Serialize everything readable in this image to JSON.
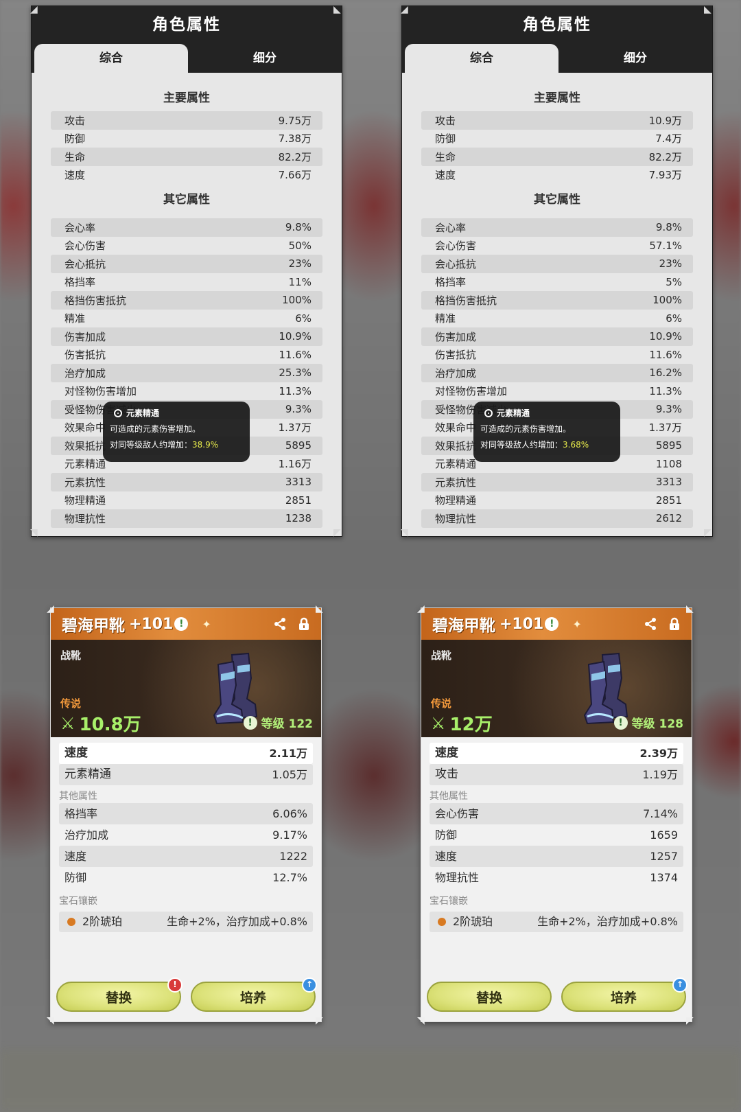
{
  "panels": [
    {
      "title": "角色属性",
      "tabs": [
        "综合",
        "细分"
      ],
      "main_title": "主要属性",
      "main": [
        {
          "label": "攻击",
          "value": "9.75万"
        },
        {
          "label": "防御",
          "value": "7.38万"
        },
        {
          "label": "生命",
          "value": "82.2万"
        },
        {
          "label": "速度",
          "value": "7.66万"
        }
      ],
      "other_title": "其它属性",
      "other": [
        {
          "label": "会心率",
          "value": "9.8%"
        },
        {
          "label": "会心伤害",
          "value": "50%"
        },
        {
          "label": "会心抵抗",
          "value": "23%"
        },
        {
          "label": "格挡率",
          "value": "11%"
        },
        {
          "label": "格挡伤害抵抗",
          "value": "100%"
        },
        {
          "label": "精准",
          "value": "6%"
        },
        {
          "label": "伤害加成",
          "value": "10.9%"
        },
        {
          "label": "伤害抵抗",
          "value": "11.6%"
        },
        {
          "label": "治疗加成",
          "value": "25.3%"
        },
        {
          "label": "对怪物伤害增加",
          "value": "11.3%"
        },
        {
          "label": "受怪物伤害减少",
          "value": "9.3%"
        },
        {
          "label": "效果命中",
          "value": "1.37万"
        },
        {
          "label": "效果抵抗",
          "value": "5895"
        },
        {
          "label": "元素精通",
          "value": "1.16万"
        },
        {
          "label": "元素抗性",
          "value": "3313"
        },
        {
          "label": "物理精通",
          "value": "2851"
        },
        {
          "label": "物理抗性",
          "value": "1238"
        }
      ],
      "tooltip": {
        "title": "元素精通",
        "desc": "可造成的元素伤害增加。",
        "compare_label": "对同等级敌人约增加：",
        "compare_value": "38.9%"
      }
    },
    {
      "title": "角色属性",
      "tabs": [
        "综合",
        "细分"
      ],
      "main_title": "主要属性",
      "main": [
        {
          "label": "攻击",
          "value": "10.9万"
        },
        {
          "label": "防御",
          "value": "7.4万"
        },
        {
          "label": "生命",
          "value": "82.2万"
        },
        {
          "label": "速度",
          "value": "7.93万"
        }
      ],
      "other_title": "其它属性",
      "other": [
        {
          "label": "会心率",
          "value": "9.8%"
        },
        {
          "label": "会心伤害",
          "value": "57.1%"
        },
        {
          "label": "会心抵抗",
          "value": "23%"
        },
        {
          "label": "格挡率",
          "value": "5%"
        },
        {
          "label": "格挡伤害抵抗",
          "value": "100%"
        },
        {
          "label": "精准",
          "value": "6%"
        },
        {
          "label": "伤害加成",
          "value": "10.9%"
        },
        {
          "label": "伤害抵抗",
          "value": "11.6%"
        },
        {
          "label": "治疗加成",
          "value": "16.2%"
        },
        {
          "label": "对怪物伤害增加",
          "value": "11.3%"
        },
        {
          "label": "受怪物伤害减少",
          "value": "9.3%"
        },
        {
          "label": "效果命中",
          "value": "1.37万"
        },
        {
          "label": "效果抵抗",
          "value": "5895"
        },
        {
          "label": "元素精通",
          "value": "1108"
        },
        {
          "label": "元素抗性",
          "value": "3313"
        },
        {
          "label": "物理精通",
          "value": "2851"
        },
        {
          "label": "物理抗性",
          "value": "2612"
        }
      ],
      "tooltip": {
        "title": "元素精通",
        "desc": "可造成的元素伤害增加。",
        "compare_label": "对同等级敌人约增加：",
        "compare_value": "3.68%"
      }
    }
  ],
  "equipment": [
    {
      "name": "碧海甲靴",
      "plus": "+101",
      "slot": "战靴",
      "rarity": "传说",
      "power": "10.8万",
      "level": "等级 122",
      "main": [
        {
          "label": "速度",
          "value": "2.11万"
        },
        {
          "label": "元素精通",
          "value": "1.05万"
        }
      ],
      "sub_title": "其他属性",
      "sub": [
        {
          "label": "格挡率",
          "value": "6.06%"
        },
        {
          "label": "治疗加成",
          "value": "9.17%"
        },
        {
          "label": "速度",
          "value": "1222"
        },
        {
          "label": "防御",
          "value": "12.7%"
        }
      ],
      "gem_title": "宝石镶嵌",
      "gem_name": "2阶琥珀",
      "gem_effect": "生命+2%，治疗加成+0.8%",
      "btn_replace": "替换",
      "btn_train": "培养"
    },
    {
      "name": "碧海甲靴",
      "plus": "+101",
      "slot": "战靴",
      "rarity": "传说",
      "power": "12万",
      "level": "等级 128",
      "main": [
        {
          "label": "速度",
          "value": "2.39万"
        },
        {
          "label": "攻击",
          "value": "1.19万"
        }
      ],
      "sub_title": "其他属性",
      "sub": [
        {
          "label": "会心伤害",
          "value": "7.14%"
        },
        {
          "label": "防御",
          "value": "1659"
        },
        {
          "label": "速度",
          "value": "1257"
        },
        {
          "label": "物理抗性",
          "value": "1374"
        }
      ],
      "gem_title": "宝石镶嵌",
      "gem_name": "2阶琥珀",
      "gem_effect": "生命+2%，治疗加成+0.8%",
      "btn_replace": "替换",
      "btn_train": "培养"
    }
  ],
  "icons": {
    "info": "!",
    "share": "share-icon",
    "lock": "lock-icon",
    "alert_badge": "!",
    "upgrade_badge": "↑",
    "sparkle": "✦"
  },
  "colors": {
    "tooltip_highlight": "#e5e84a",
    "rarity": "#f49a3c",
    "power": "#a8f06a"
  }
}
